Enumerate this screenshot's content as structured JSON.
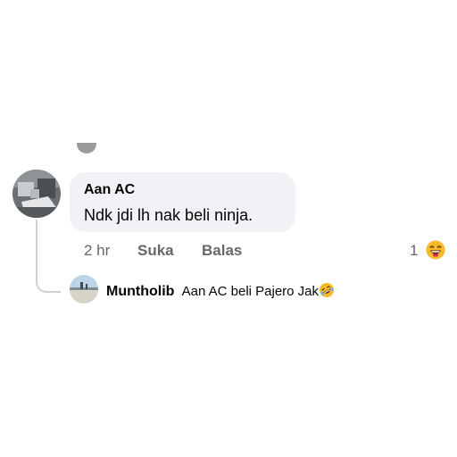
{
  "comment": {
    "author": "Aan AC",
    "text": "Ndk jdi lh nak beli ninja.",
    "time": "2 hr",
    "like_label": "Suka",
    "reply_label": "Balas",
    "reaction_count": "1",
    "reaction_icon": "laughing-emoji-icon"
  },
  "reply": {
    "author": "Muntholib",
    "text": "Aan AC beli Pajero Jak",
    "emoji_icon": "rolling-laughing-emoji-icon"
  },
  "colors": {
    "bubble": "#f0f2f5",
    "meta_text": "#65676b",
    "thread_line": "#ced0d4"
  }
}
